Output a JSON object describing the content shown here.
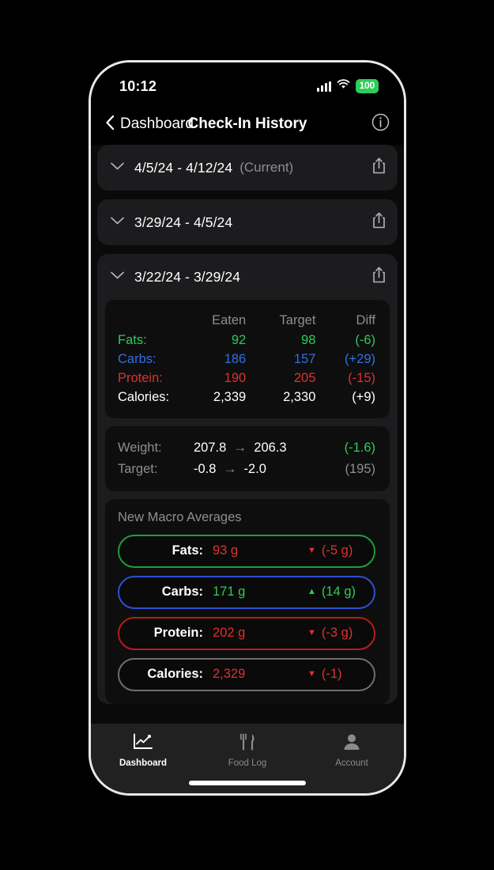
{
  "status_bar": {
    "time": "10:12",
    "battery": "100",
    "signal_icon": "cellular-bars-icon",
    "wifi_icon": "wifi-icon"
  },
  "nav": {
    "back_label": "Dashboard",
    "title": "Check-In History",
    "info_icon": "info-circle-icon",
    "back_icon": "chevron-left-icon"
  },
  "colors": {
    "fats": "#2ecc58",
    "carbs": "#2f6fe4",
    "protein": "#e03030",
    "calories": "#ffffff",
    "muted": "#8e8e93",
    "up": "#2ecc58",
    "down": "#e03030"
  },
  "check_ins": [
    {
      "range": "4/5/24 - 4/12/24",
      "note": "(Current)",
      "expanded": false,
      "chevron_icon": "chevron-down-icon",
      "share_icon": "share-icon"
    },
    {
      "range": "3/29/24 - 4/5/24",
      "note": "",
      "expanded": false,
      "chevron_icon": "chevron-down-icon",
      "share_icon": "share-icon"
    },
    {
      "range": "3/22/24 - 3/29/24",
      "note": "",
      "expanded": true,
      "chevron_icon": "chevron-down-icon",
      "share_icon": "share-icon"
    }
  ],
  "macro_table": {
    "headers": {
      "eaten": "Eaten",
      "target": "Target",
      "diff": "Diff"
    },
    "rows": [
      {
        "label": "Fats:",
        "eaten": "92",
        "target": "98",
        "diff": "(-6)",
        "color": "#2ecc58"
      },
      {
        "label": "Carbs:",
        "eaten": "186",
        "target": "157",
        "diff": "(+29)",
        "color": "#2f6fe4"
      },
      {
        "label": "Protein:",
        "eaten": "190",
        "target": "205",
        "diff": "(-15)",
        "color": "#e03030"
      },
      {
        "label": "Calories:",
        "eaten": "2,339",
        "target": "2,330",
        "diff": "(+9)",
        "color": "#ffffff"
      }
    ]
  },
  "weight_panel": {
    "rows": [
      {
        "label": "Weight:",
        "from": "207.8",
        "arrow": "→",
        "to": "206.3",
        "delta": "(-1.6)",
        "delta_color": "#2ecc58"
      },
      {
        "label": "Target:",
        "from": "-0.8",
        "arrow": "→",
        "to": "-2.0",
        "delta": "(195)",
        "delta_color": "#8e8e93"
      }
    ]
  },
  "averages_panel": {
    "title": "New Macro Averages",
    "pills": [
      {
        "label": "Fats:",
        "value": "93 g",
        "value_color": "#e03030",
        "direction": "down",
        "delta": "(-5 g)",
        "delta_color": "#e03030",
        "border_color": "#1f9d3a",
        "arrow_icon": "triangle-down-icon"
      },
      {
        "label": "Carbs:",
        "value": "171 g",
        "value_color": "#2ecc58",
        "direction": "up",
        "delta": "(14 g)",
        "delta_color": "#2ecc58",
        "border_color": "#2f4fd4",
        "arrow_icon": "triangle-up-icon"
      },
      {
        "label": "Protein:",
        "value": "202 g",
        "value_color": "#e03030",
        "direction": "down",
        "delta": "(-3 g)",
        "delta_color": "#e03030",
        "border_color": "#b81c1c",
        "arrow_icon": "triangle-down-icon"
      },
      {
        "label": "Calories:",
        "value": "2,329",
        "value_color": "#e03030",
        "direction": "down",
        "delta": "(-1)",
        "delta_color": "#e03030",
        "border_color": "#6e6e6e",
        "arrow_icon": "triangle-down-icon"
      }
    ]
  },
  "tabs": [
    {
      "label": "Dashboard",
      "icon": "chart-line-icon",
      "active": true
    },
    {
      "label": "Food Log",
      "icon": "fork-knife-icon",
      "active": false
    },
    {
      "label": "Account",
      "icon": "person-icon",
      "active": false
    }
  ]
}
